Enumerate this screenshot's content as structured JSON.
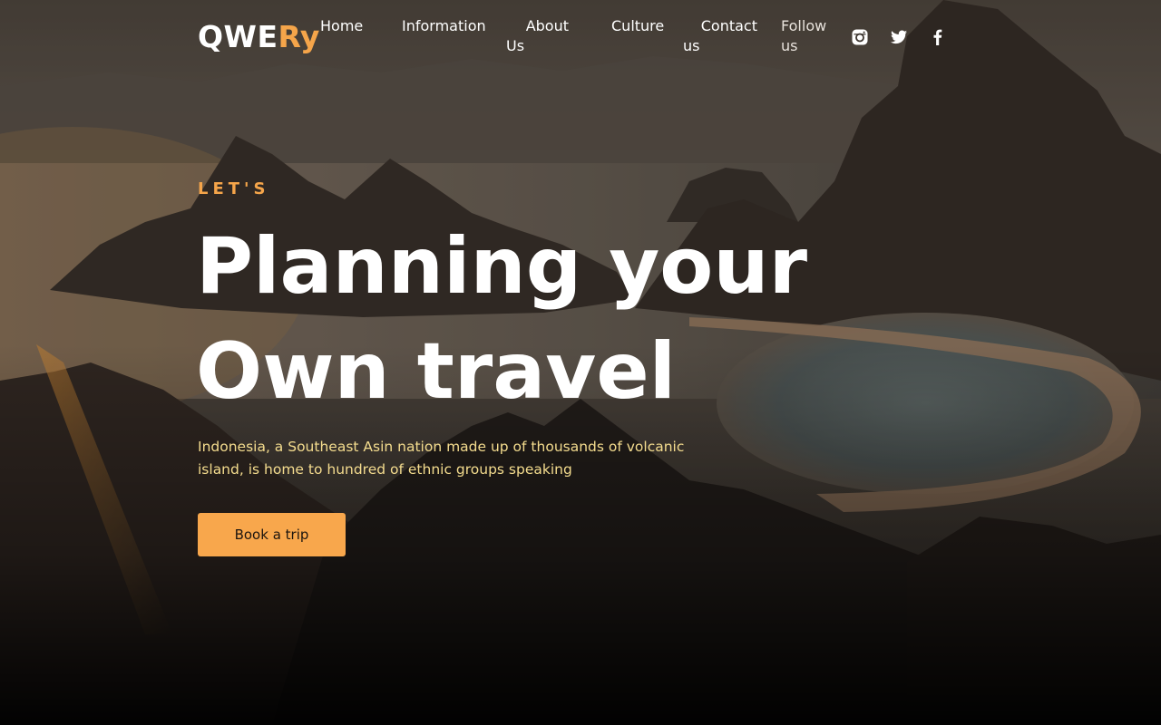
{
  "colors": {
    "accent": "#f5a54a",
    "button": "#f8a74c",
    "subtitle": "#f4dc8e",
    "text": "#ffffff"
  },
  "brand": {
    "logo_part1": "QWE",
    "logo_part2": "Ry"
  },
  "nav": {
    "home": "Home",
    "information": "Information",
    "about_line1": "About",
    "about_line2": "Us",
    "culture": "Culture",
    "contact_line1": "Contact",
    "contact_line2": "us"
  },
  "social": {
    "follow_line1": "Follow",
    "follow_line2": "us",
    "icons": [
      "instagram-icon",
      "twitter-icon",
      "facebook-icon"
    ]
  },
  "hero": {
    "eyebrow": "LET'S",
    "headline_line1": "Planning your",
    "headline_line2": "Own travel",
    "subtitle": "Indonesia, a Southeast Asin nation made up of thousands of volcanic island, is home to hundred of ethnic groups speaking",
    "cta_label": "Book a trip"
  }
}
